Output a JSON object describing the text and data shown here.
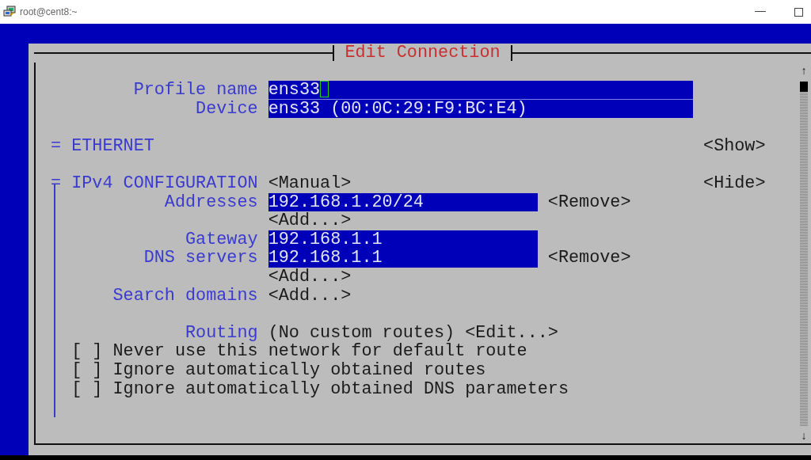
{
  "window": {
    "title": "root@cent8:~"
  },
  "dialog": {
    "title": "Edit Connection"
  },
  "profile_fields": [
    {
      "label": "Profile name",
      "value": "ens33",
      "focused": true
    },
    {
      "label": "Device",
      "value": "ens33 (00:0C:29:F9:BC:E4)",
      "focused": false
    }
  ],
  "sections": [
    {
      "marker": "=",
      "title": "ETHERNET",
      "expanded": false,
      "toggle": "<Show>"
    },
    {
      "marker": "=",
      "title": "IPv4 CONFIGURATION",
      "mode": "<Manual>",
      "expanded": true,
      "toggle": "<Hide>",
      "rows": [
        {
          "kind": "field",
          "label": "Addresses",
          "value": "192.168.1.20/24",
          "action": "<Remove>"
        },
        {
          "kind": "button",
          "text": "<Add...>"
        },
        {
          "kind": "field",
          "label": "Gateway",
          "value": "192.168.1.1"
        },
        {
          "kind": "field",
          "label": "DNS servers",
          "value": "192.168.1.1",
          "action": "<Remove>"
        },
        {
          "kind": "button",
          "text": "<Add...>"
        },
        {
          "kind": "button",
          "label": "Search domains",
          "text": "<Add...>"
        },
        {
          "kind": "routing",
          "label": "Routing",
          "value": "(No custom routes)",
          "text": "<Edit...>"
        },
        {
          "kind": "checkbox",
          "box": "[ ]",
          "checked": false,
          "text": "Never use this network for default route"
        },
        {
          "kind": "checkbox",
          "box": "[ ]",
          "checked": false,
          "text": "Ignore automatically obtained routes"
        },
        {
          "kind": "checkbox",
          "box": "[ ]",
          "checked": false,
          "text": "Ignore automatically obtained DNS parameters"
        }
      ]
    }
  ],
  "scrollbar": {
    "up": "↑",
    "down": "↓"
  }
}
